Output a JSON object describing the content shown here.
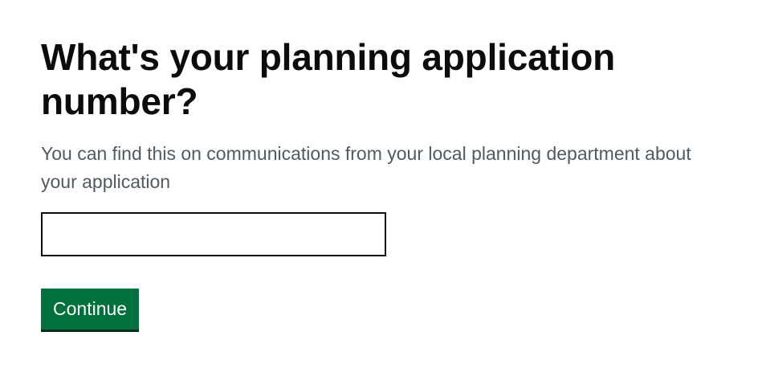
{
  "question": {
    "title": "What's your planning application number?",
    "hint": "You can find this on communications from your local planning department about your application"
  },
  "application_number_input": {
    "value": "",
    "placeholder": ""
  },
  "actions": {
    "continue_label": "Continue"
  },
  "colors": {
    "text": "#0b0c0c",
    "hint": "#505a5f",
    "button": "#00703c",
    "button_shadow": "#002d18"
  }
}
